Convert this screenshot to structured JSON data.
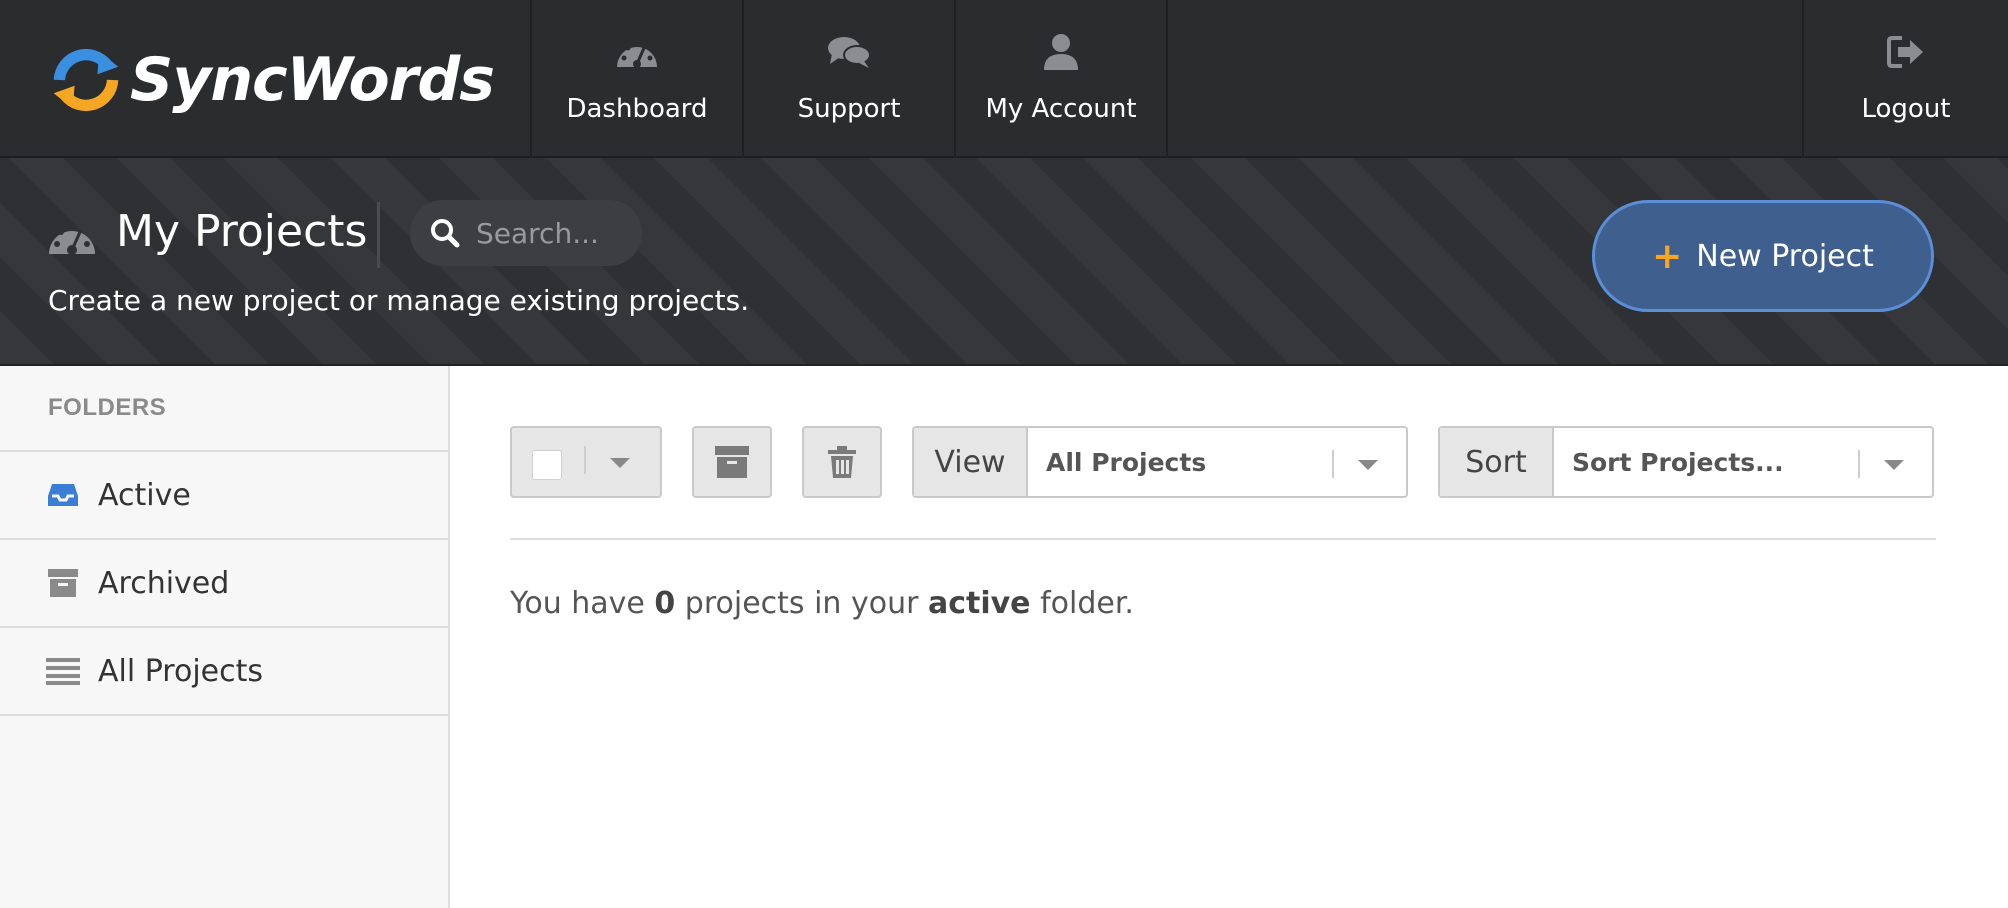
{
  "brand": {
    "name": "SyncWords",
    "logo_icon": "syncwords-logo-icon"
  },
  "nav": {
    "items": [
      {
        "label": "Dashboard",
        "icon": "dashboard-gauge-icon"
      },
      {
        "label": "Support",
        "icon": "chat-bubbles-icon"
      },
      {
        "label": "My Account",
        "icon": "user-icon"
      }
    ],
    "logout": {
      "label": "Logout",
      "icon": "logout-icon"
    }
  },
  "header": {
    "title": "My Projects",
    "subtitle": "Create a new project or manage existing projects.",
    "search_placeholder": "Search...",
    "new_project_label": "New Project"
  },
  "sidebar": {
    "heading": "FOLDERS",
    "items": [
      {
        "label": "Active",
        "icon": "inbox-icon",
        "icon_color": "#3a7fd5"
      },
      {
        "label": "Archived",
        "icon": "archive-box-icon",
        "icon_color": "#8a8a8a"
      },
      {
        "label": "All Projects",
        "icon": "list-icon",
        "icon_color": "#8a8a8a"
      }
    ]
  },
  "toolbar": {
    "view_label": "View",
    "view_value": "All Projects",
    "sort_label": "Sort",
    "sort_value": "Sort Projects..."
  },
  "main": {
    "message": {
      "prefix": "You have ",
      "count": "0",
      "middle": " projects in your ",
      "folder": "active",
      "suffix": " folder."
    }
  },
  "colors": {
    "nav_bg": "#2b2c2e",
    "accent_blue": "#3f5f8e",
    "accent_orange": "#f5a623"
  }
}
